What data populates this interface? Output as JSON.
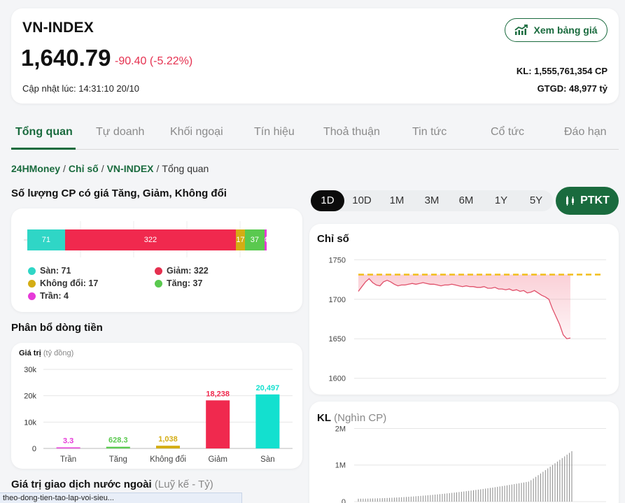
{
  "header": {
    "index_name": "VN-INDEX",
    "index_value": "1,640.79",
    "index_change": "-90.40 (-5.22%)",
    "update_time": "Cập nhật lúc: 14:31:10 20/10",
    "board_button": "Xem bảng giá",
    "volume": "KL: 1,555,761,354 CP",
    "trade_value": "GTGD: 48,977 tỷ"
  },
  "colors": {
    "brand": "#1a6b3e",
    "down": "#e5304f",
    "floor": "#2fd6c6",
    "ceiling": "#e63ad8",
    "unchanged": "#d4ad14",
    "up": "#5ac94f"
  },
  "tabs": [
    "Tổng quan",
    "Tự doanh",
    "Khối ngoại",
    "Tín hiệu",
    "Thoả thuận",
    "Tin tức",
    "Cổ tức",
    "Đáo hạn"
  ],
  "breadcrumb": {
    "home": "24HMoney",
    "category": "Chỉ số",
    "index": "VN-INDEX",
    "current": "Tổng quan"
  },
  "stock_count": {
    "title": "Số lượng CP có giá Tăng, Giảm, Không đổi",
    "segments": [
      {
        "key": "floor",
        "value": 71,
        "label": "71"
      },
      {
        "key": "down",
        "value": 322,
        "label": "322"
      },
      {
        "key": "unchanged",
        "value": 17,
        "label": "17"
      },
      {
        "key": "up",
        "value": 37,
        "label": "37"
      },
      {
        "key": "ceiling",
        "value": 4,
        "label": "4"
      }
    ],
    "legend": {
      "floor": "Sàn: 71",
      "down": "Giảm: 322",
      "unchanged": "Không đổi: 17",
      "up": "Tăng: 37",
      "ceiling": "Trần: 4"
    }
  },
  "money_flow": {
    "title": "Phân bổ dòng tiền",
    "ylabel": "Giá trị",
    "yunit": "(tỷ đồng)"
  },
  "periods": [
    "1D",
    "10D",
    "1M",
    "3M",
    "6M",
    "1Y",
    "5Y"
  ],
  "active_period": "1D",
  "ptkt_button": "PTKT",
  "index_chart": {
    "title": "Chỉ số"
  },
  "kl_chart": {
    "title": "KL",
    "unit": "(Nghìn CP)"
  },
  "foreign": {
    "title": "Giá trị giao dịch nước ngoài",
    "unit": "(Luỹ kế - Tỷ)"
  },
  "status_url": "theo-dong-tien-tao-lap-voi-sieu...",
  "chart_data": [
    {
      "type": "bar",
      "title": "",
      "xlabel": "",
      "ylabel": "Giá trị (tỷ đồng)",
      "categories": [
        "Trần",
        "Tăng",
        "Không đổi",
        "Giảm",
        "Sàn"
      ],
      "values": [
        3.3,
        628.3,
        1038,
        18238,
        20497
      ],
      "value_labels": [
        "3.3",
        "628.3",
        "1,038",
        "18,238",
        "20,497"
      ],
      "colors": [
        "#e63ad8",
        "#5ac94f",
        "#d4ad14",
        "#f0294e",
        "#13e0cf"
      ],
      "yticks": [
        0,
        10000,
        20000,
        30000
      ],
      "ytick_labels": [
        "0",
        "10k",
        "20k",
        "30k"
      ],
      "ylim": [
        0,
        30000
      ],
      "grid": true
    },
    {
      "type": "line",
      "title": "Chỉ số",
      "yticks": [
        1600,
        1650,
        1700,
        1750
      ],
      "ytick_labels": [
        "1600",
        "1650",
        "1700",
        "1750"
      ],
      "ylim": [
        1590,
        1760
      ],
      "reference": 1731.19,
      "grid": true,
      "values": [
        1710,
        1716,
        1722,
        1726,
        1721,
        1718,
        1717,
        1722,
        1724,
        1722,
        1719,
        1717,
        1718,
        1718,
        1719,
        1720,
        1719,
        1720,
        1721,
        1720,
        1719,
        1719,
        1718,
        1717,
        1718,
        1718,
        1719,
        1718,
        1717,
        1716,
        1717,
        1716,
        1716,
        1715,
        1715,
        1716,
        1714,
        1714,
        1715,
        1713,
        1713,
        1712,
        1713,
        1711,
        1712,
        1710,
        1711,
        1708,
        1709,
        1711,
        1708,
        1705,
        1703,
        1700,
        1688,
        1678,
        1668,
        1655,
        1650,
        1651
      ]
    },
    {
      "type": "bar",
      "title": "KL",
      "ylabel": "(Nghìn CP)",
      "yticks": [
        0,
        1000,
        2000
      ],
      "ytick_labels": [
        "0",
        "1M",
        "2M"
      ],
      "ylim": [
        0,
        2200
      ],
      "grid": true
    }
  ]
}
